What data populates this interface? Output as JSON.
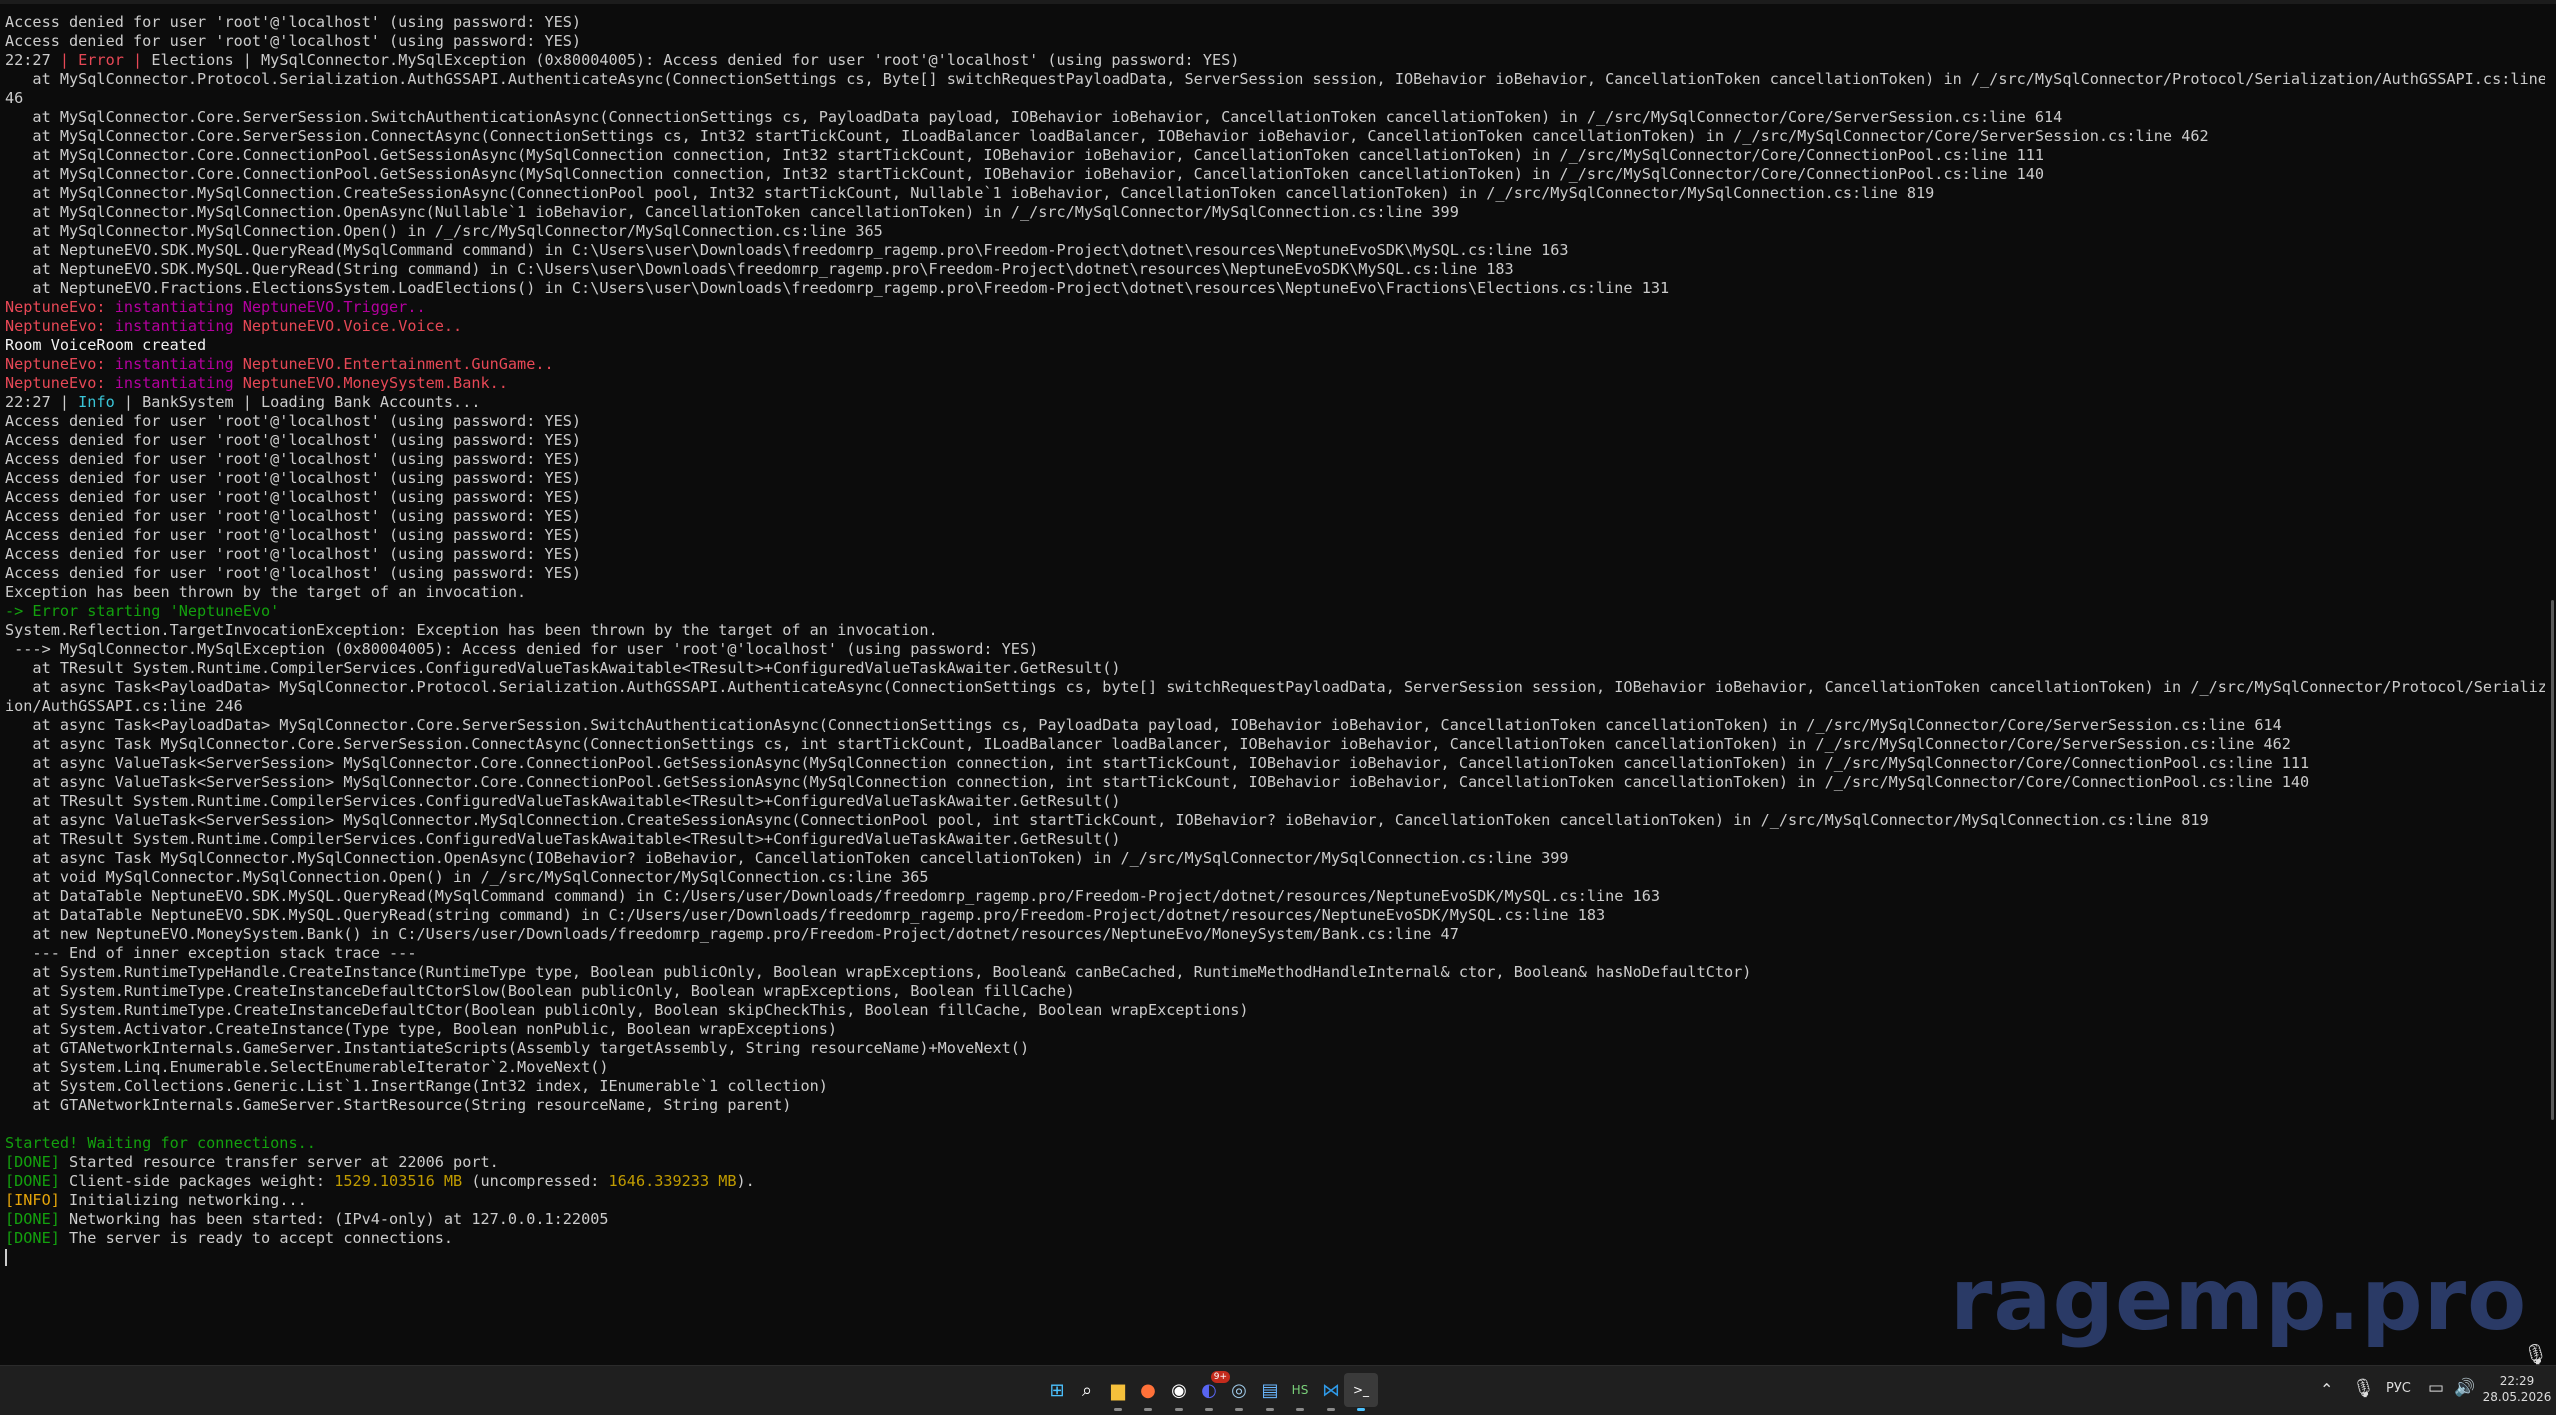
{
  "console": {
    "lines": [
      [
        [
          "default",
          "Access denied for user 'root'@'localhost' (using password: YES)"
        ]
      ],
      [
        [
          "default",
          "Access denied for user 'root'@'localhost' (using password: YES)"
        ]
      ],
      [
        [
          "default",
          "22:27 "
        ],
        [
          "red",
          "| Error |"
        ],
        [
          "default",
          " Elections | MySqlConnector.MySqlException (0x80004005): Access denied for user 'root'@'localhost' (using password: YES)"
        ]
      ],
      [
        [
          "default",
          "   at MySqlConnector.Protocol.Serialization.AuthGSSAPI.AuthenticateAsync(ConnectionSettings cs, Byte[] switchRequestPayloadData, ServerSession session, IOBehavior ioBehavior, CancellationToken cancellationToken) in /_/src/MySqlConnector/Protocol/Serialization/AuthGSSAPI.cs:line 2"
        ]
      ],
      [
        [
          "default",
          "46"
        ]
      ],
      [
        [
          "default",
          "   at MySqlConnector.Core.ServerSession.SwitchAuthenticationAsync(ConnectionSettings cs, PayloadData payload, IOBehavior ioBehavior, CancellationToken cancellationToken) in /_/src/MySqlConnector/Core/ServerSession.cs:line 614"
        ]
      ],
      [
        [
          "default",
          "   at MySqlConnector.Core.ServerSession.ConnectAsync(ConnectionSettings cs, Int32 startTickCount, ILoadBalancer loadBalancer, IOBehavior ioBehavior, CancellationToken cancellationToken) in /_/src/MySqlConnector/Core/ServerSession.cs:line 462"
        ]
      ],
      [
        [
          "default",
          "   at MySqlConnector.Core.ConnectionPool.GetSessionAsync(MySqlConnection connection, Int32 startTickCount, IOBehavior ioBehavior, CancellationToken cancellationToken) in /_/src/MySqlConnector/Core/ConnectionPool.cs:line 111"
        ]
      ],
      [
        [
          "default",
          "   at MySqlConnector.Core.ConnectionPool.GetSessionAsync(MySqlConnection connection, Int32 startTickCount, IOBehavior ioBehavior, CancellationToken cancellationToken) in /_/src/MySqlConnector/Core/ConnectionPool.cs:line 140"
        ]
      ],
      [
        [
          "default",
          "   at MySqlConnector.MySqlConnection.CreateSessionAsync(ConnectionPool pool, Int32 startTickCount, Nullable`1 ioBehavior, CancellationToken cancellationToken) in /_/src/MySqlConnector/MySqlConnection.cs:line 819"
        ]
      ],
      [
        [
          "default",
          "   at MySqlConnector.MySqlConnection.OpenAsync(Nullable`1 ioBehavior, CancellationToken cancellationToken) in /_/src/MySqlConnector/MySqlConnection.cs:line 399"
        ]
      ],
      [
        [
          "default",
          "   at MySqlConnector.MySqlConnection.Open() in /_/src/MySqlConnector/MySqlConnection.cs:line 365"
        ]
      ],
      [
        [
          "default",
          "   at NeptuneEVO.SDK.MySQL.QueryRead(MySqlCommand command) in C:\\Users\\user\\Downloads\\freedomrp_ragemp.pro\\Freedom-Project\\dotnet\\resources\\NeptuneEvoSDK\\MySQL.cs:line 163"
        ]
      ],
      [
        [
          "default",
          "   at NeptuneEVO.SDK.MySQL.QueryRead(String command) in C:\\Users\\user\\Downloads\\freedomrp_ragemp.pro\\Freedom-Project\\dotnet\\resources\\NeptuneEvoSDK\\MySQL.cs:line 183"
        ]
      ],
      [
        [
          "default",
          "   at NeptuneEVO.Fractions.ElectionsSystem.LoadElections() in C:\\Users\\user\\Downloads\\freedomrp_ragemp.pro\\Freedom-Project\\dotnet\\resources\\NeptuneEvo\\Fractions\\Elections.cs:line 131"
        ]
      ],
      [
        [
          "red",
          "NeptuneEvo: "
        ],
        [
          "purple",
          "instantiating NeptuneEVO.Trigger.."
        ]
      ],
      [
        [
          "red",
          "NeptuneEvo: "
        ],
        [
          "purple",
          "instantiating "
        ],
        [
          "red",
          "NeptuneEVO.Voice.Voice.."
        ]
      ],
      [
        [
          "white",
          "Room VoiceRoom created"
        ]
      ],
      [
        [
          "red",
          "NeptuneEvo: "
        ],
        [
          "purple",
          "instantiating "
        ],
        [
          "red",
          "NeptuneEVO.Entertainment.GunGame.."
        ]
      ],
      [
        [
          "red",
          "NeptuneEvo: "
        ],
        [
          "purple",
          "instantiating "
        ],
        [
          "red",
          "NeptuneEVO.MoneySystem.Bank.."
        ]
      ],
      [
        [
          "default",
          "22:27 | "
        ],
        [
          "cyan",
          "Info"
        ],
        [
          "default",
          " | BankSystem | Loading Bank Accounts..."
        ]
      ],
      [
        [
          "default",
          "Access denied for user 'root'@'localhost' (using password: YES)"
        ]
      ],
      [
        [
          "default",
          "Access denied for user 'root'@'localhost' (using password: YES)"
        ]
      ],
      [
        [
          "default",
          "Access denied for user 'root'@'localhost' (using password: YES)"
        ]
      ],
      [
        [
          "default",
          "Access denied for user 'root'@'localhost' (using password: YES)"
        ]
      ],
      [
        [
          "default",
          "Access denied for user 'root'@'localhost' (using password: YES)"
        ]
      ],
      [
        [
          "default",
          "Access denied for user 'root'@'localhost' (using password: YES)"
        ]
      ],
      [
        [
          "default",
          "Access denied for user 'root'@'localhost' (using password: YES)"
        ]
      ],
      [
        [
          "default",
          "Access denied for user 'root'@'localhost' (using password: YES)"
        ]
      ],
      [
        [
          "default",
          "Access denied for user 'root'@'localhost' (using password: YES)"
        ]
      ],
      [
        [
          "default",
          "Exception has been thrown by the target of an invocation."
        ]
      ],
      [
        [
          "green",
          "-> Error starting 'NeptuneEvo'"
        ]
      ],
      [
        [
          "default",
          "System.Reflection.TargetInvocationException: Exception has been thrown by the target of an invocation."
        ]
      ],
      [
        [
          "default",
          " ---> MySqlConnector.MySqlException (0x80004005): Access denied for user 'root'@'localhost' (using password: YES)"
        ]
      ],
      [
        [
          "default",
          "   at TResult System.Runtime.CompilerServices.ConfiguredValueTaskAwaitable<TResult>+ConfiguredValueTaskAwaiter.GetResult()"
        ]
      ],
      [
        [
          "default",
          "   at async Task<PayloadData> MySqlConnector.Protocol.Serialization.AuthGSSAPI.AuthenticateAsync(ConnectionSettings cs, byte[] switchRequestPayloadData, ServerSession session, IOBehavior ioBehavior, CancellationToken cancellationToken) in /_/src/MySqlConnector/Protocol/Serializat"
        ]
      ],
      [
        [
          "default",
          "ion/AuthGSSAPI.cs:line 246"
        ]
      ],
      [
        [
          "default",
          "   at async Task<PayloadData> MySqlConnector.Core.ServerSession.SwitchAuthenticationAsync(ConnectionSettings cs, PayloadData payload, IOBehavior ioBehavior, CancellationToken cancellationToken) in /_/src/MySqlConnector/Core/ServerSession.cs:line 614"
        ]
      ],
      [
        [
          "default",
          "   at async Task MySqlConnector.Core.ServerSession.ConnectAsync(ConnectionSettings cs, int startTickCount, ILoadBalancer loadBalancer, IOBehavior ioBehavior, CancellationToken cancellationToken) in /_/src/MySqlConnector/Core/ServerSession.cs:line 462"
        ]
      ],
      [
        [
          "default",
          "   at async ValueTask<ServerSession> MySqlConnector.Core.ConnectionPool.GetSessionAsync(MySqlConnection connection, int startTickCount, IOBehavior ioBehavior, CancellationToken cancellationToken) in /_/src/MySqlConnector/Core/ConnectionPool.cs:line 111"
        ]
      ],
      [
        [
          "default",
          "   at async ValueTask<ServerSession> MySqlConnector.Core.ConnectionPool.GetSessionAsync(MySqlConnection connection, int startTickCount, IOBehavior ioBehavior, CancellationToken cancellationToken) in /_/src/MySqlConnector/Core/ConnectionPool.cs:line 140"
        ]
      ],
      [
        [
          "default",
          "   at TResult System.Runtime.CompilerServices.ConfiguredValueTaskAwaitable<TResult>+ConfiguredValueTaskAwaiter.GetResult()"
        ]
      ],
      [
        [
          "default",
          "   at async ValueTask<ServerSession> MySqlConnector.MySqlConnection.CreateSessionAsync(ConnectionPool pool, int startTickCount, IOBehavior? ioBehavior, CancellationToken cancellationToken) in /_/src/MySqlConnector/MySqlConnection.cs:line 819"
        ]
      ],
      [
        [
          "default",
          "   at TResult System.Runtime.CompilerServices.ConfiguredValueTaskAwaitable<TResult>+ConfiguredValueTaskAwaiter.GetResult()"
        ]
      ],
      [
        [
          "default",
          "   at async Task MySqlConnector.MySqlConnection.OpenAsync(IOBehavior? ioBehavior, CancellationToken cancellationToken) in /_/src/MySqlConnector/MySqlConnection.cs:line 399"
        ]
      ],
      [
        [
          "default",
          "   at void MySqlConnector.MySqlConnection.Open() in /_/src/MySqlConnector/MySqlConnection.cs:line 365"
        ]
      ],
      [
        [
          "default",
          "   at DataTable NeptuneEVO.SDK.MySQL.QueryRead(MySqlCommand command) in C:/Users/user/Downloads/freedomrp_ragemp.pro/Freedom-Project/dotnet/resources/NeptuneEvoSDK/MySQL.cs:line 163"
        ]
      ],
      [
        [
          "default",
          "   at DataTable NeptuneEVO.SDK.MySQL.QueryRead(string command) in C:/Users/user/Downloads/freedomrp_ragemp.pro/Freedom-Project/dotnet/resources/NeptuneEvoSDK/MySQL.cs:line 183"
        ]
      ],
      [
        [
          "default",
          "   at new NeptuneEVO.MoneySystem.Bank() in C:/Users/user/Downloads/freedomrp_ragemp.pro/Freedom-Project/dotnet/resources/NeptuneEvo/MoneySystem/Bank.cs:line 47"
        ]
      ],
      [
        [
          "default",
          "   --- End of inner exception stack trace ---"
        ]
      ],
      [
        [
          "default",
          "   at System.RuntimeTypeHandle.CreateInstance(RuntimeType type, Boolean publicOnly, Boolean wrapExceptions, Boolean& canBeCached, RuntimeMethodHandleInternal& ctor, Boolean& hasNoDefaultCtor)"
        ]
      ],
      [
        [
          "default",
          "   at System.RuntimeType.CreateInstanceDefaultCtorSlow(Boolean publicOnly, Boolean wrapExceptions, Boolean fillCache)"
        ]
      ],
      [
        [
          "default",
          "   at System.RuntimeType.CreateInstanceDefaultCtor(Boolean publicOnly, Boolean skipCheckThis, Boolean fillCache, Boolean wrapExceptions)"
        ]
      ],
      [
        [
          "default",
          "   at System.Activator.CreateInstance(Type type, Boolean nonPublic, Boolean wrapExceptions)"
        ]
      ],
      [
        [
          "default",
          "   at GTANetworkInternals.GameServer.InstantiateScripts(Assembly targetAssembly, String resourceName)+MoveNext()"
        ]
      ],
      [
        [
          "default",
          "   at System.Linq.Enumerable.SelectEnumerableIterator`2.MoveNext()"
        ]
      ],
      [
        [
          "default",
          "   at System.Collections.Generic.List`1.InsertRange(Int32 index, IEnumerable`1 collection)"
        ]
      ],
      [
        [
          "default",
          "   at GTANetworkInternals.GameServer.StartResource(String resourceName, String parent)"
        ]
      ],
      [],
      [
        [
          "green",
          "Started! Waiting for connections.."
        ]
      ],
      [
        [
          "green",
          "[DONE]"
        ],
        [
          "default",
          " Started resource transfer server at 22006 port."
        ]
      ],
      [
        [
          "green",
          "[DONE]"
        ],
        [
          "default",
          " Client-side packages weight: "
        ],
        [
          "yellow",
          "1529.103516 MB"
        ],
        [
          "default",
          " (uncompressed: "
        ],
        [
          "yellow",
          "1646.339233 MB"
        ],
        [
          "default",
          ")."
        ]
      ],
      [
        [
          "orange",
          "[INFO]"
        ],
        [
          "default",
          " Initializing networking..."
        ]
      ],
      [
        [
          "green",
          "[DONE]"
        ],
        [
          "default",
          " Networking has been started: (IPv4-only) at 127.0.0.1:22005"
        ]
      ],
      [
        [
          "green",
          "[DONE]"
        ],
        [
          "default",
          " The server is ready to accept connections."
        ]
      ]
    ]
  },
  "watermark": "ragemp.pro",
  "taskbar": {
    "apps": [
      {
        "name": "start-icon",
        "glyph": "⊞",
        "color": "#4cc2ff"
      },
      {
        "name": "search-icon",
        "glyph": "⌕",
        "color": "#ffffff"
      },
      {
        "name": "file-explorer-icon",
        "glyph": "▆",
        "color": "#f5c03b"
      },
      {
        "name": "firefox-icon",
        "glyph": "●",
        "color": "#ff7139"
      },
      {
        "name": "chatgpt-icon",
        "glyph": "◉",
        "color": "#ffffff"
      },
      {
        "name": "discord-icon",
        "glyph": "◐",
        "color": "#5865f2",
        "badge": "9+"
      },
      {
        "name": "steam-icon",
        "glyph": "◎",
        "color": "#9ec8e6"
      },
      {
        "name": "notepad-icon",
        "glyph": "▤",
        "color": "#6ab7ff"
      },
      {
        "name": "hs-app-icon",
        "glyph": "HS",
        "color": "#7ad07a"
      },
      {
        "name": "vscode-icon",
        "glyph": "⋈",
        "color": "#2f9ae8"
      },
      {
        "name": "terminal-icon",
        "glyph": ">_",
        "color": "#ffffff",
        "active": true
      }
    ],
    "tray": {
      "chevron": "⌃",
      "mic": "🎙",
      "language": "РУС",
      "network": "▭",
      "volume": "🔊",
      "time": "22:29",
      "date": "28.05.2026"
    }
  }
}
